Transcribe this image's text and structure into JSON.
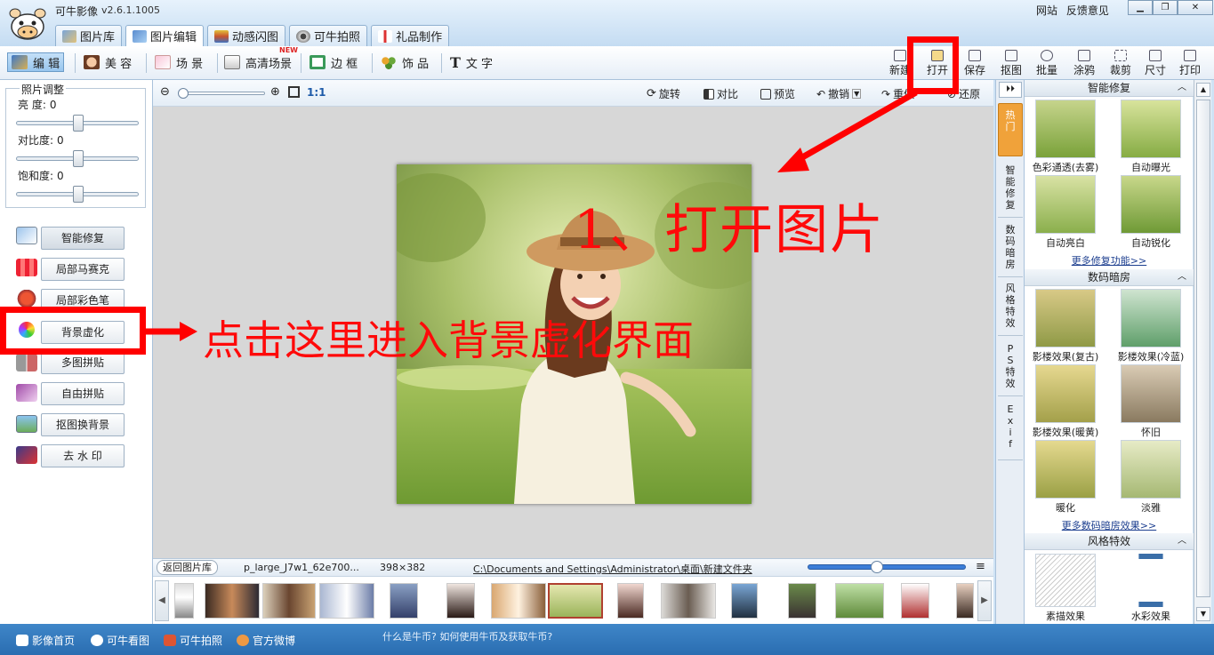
{
  "app": {
    "title": "可牛影像",
    "version": "v2.6.1.1005"
  },
  "top_links": [
    "网站",
    "反馈意见"
  ],
  "tabs": [
    {
      "label": "图片库",
      "active": false
    },
    {
      "label": "图片编辑",
      "active": true
    },
    {
      "label": "动感闪图",
      "active": false
    },
    {
      "label": "可牛拍照",
      "active": false
    },
    {
      "label": "礼品制作",
      "active": false
    }
  ],
  "toolbar": {
    "left": [
      {
        "label": "编 辑",
        "active": true
      },
      {
        "label": "美 容"
      },
      {
        "label": "场 景"
      },
      {
        "label": "高清场景",
        "badge": "NEW"
      },
      {
        "label": "边 框"
      },
      {
        "label": "饰 品"
      },
      {
        "label": "文 字"
      }
    ],
    "right": [
      "新建",
      "打开",
      "保存",
      "抠图",
      "批量",
      "涂鸦",
      "裁剪",
      "尺寸",
      "打印"
    ]
  },
  "left_panel": {
    "group_title": "照片调整",
    "sliders": [
      {
        "label": "亮  度:",
        "value": "0",
        "level": 0.5
      },
      {
        "label": "对比度:",
        "value": "0",
        "level": 0.5
      },
      {
        "label": "饱和度:",
        "value": "0",
        "level": 0.5
      }
    ],
    "features": [
      "智能修复",
      "局部马赛克",
      "局部彩色笔",
      "背景虚化",
      "多图拼贴",
      "自由拼贴",
      "抠图换背景",
      "去 水 印"
    ]
  },
  "editor": {
    "zoom_ratio": "1:1",
    "tools": [
      "旋转",
      "对比",
      "预览",
      "撤销",
      "重做",
      "还原"
    ]
  },
  "info_bar": {
    "back_button": "返回图片库",
    "filename": "p_large_J7w1_62e700...",
    "dimensions": "398×382",
    "path": "C:\\Documents and Settings\\Administrator\\桌面\\新建文件夹"
  },
  "right_tabs": [
    "热门",
    "智能修复",
    "数码暗房",
    "风格特效",
    "PS特效",
    "Exif"
  ],
  "right_panel": {
    "sections": [
      {
        "title": "智能修复",
        "items": [
          "色彩通透(去雾)",
          "自动曝光",
          "自动亮白",
          "自动锐化"
        ],
        "more": "更多修复功能>>"
      },
      {
        "title": "数码暗房",
        "items": [
          "影楼效果(复古)",
          "影楼效果(冷蓝)",
          "影楼效果(暖黄)",
          "怀旧",
          "暖化",
          "淡雅"
        ],
        "more": "更多数码暗房效果>>"
      },
      {
        "title": "风格特效",
        "items": [
          "素描效果",
          "水彩效果"
        ]
      }
    ]
  },
  "bottom_bar": {
    "items": [
      "影像首页",
      "可牛看图",
      "可牛拍照",
      "官方微博"
    ],
    "ticker": "什么是牛币? 如何使用牛币及获取牛币?"
  },
  "annotations": {
    "step_one": "1、打开图片",
    "step_two": "点击这里进入背景虚化界面"
  },
  "colors": {
    "annotation": "#ff0000",
    "accent": "#2a6db1"
  }
}
